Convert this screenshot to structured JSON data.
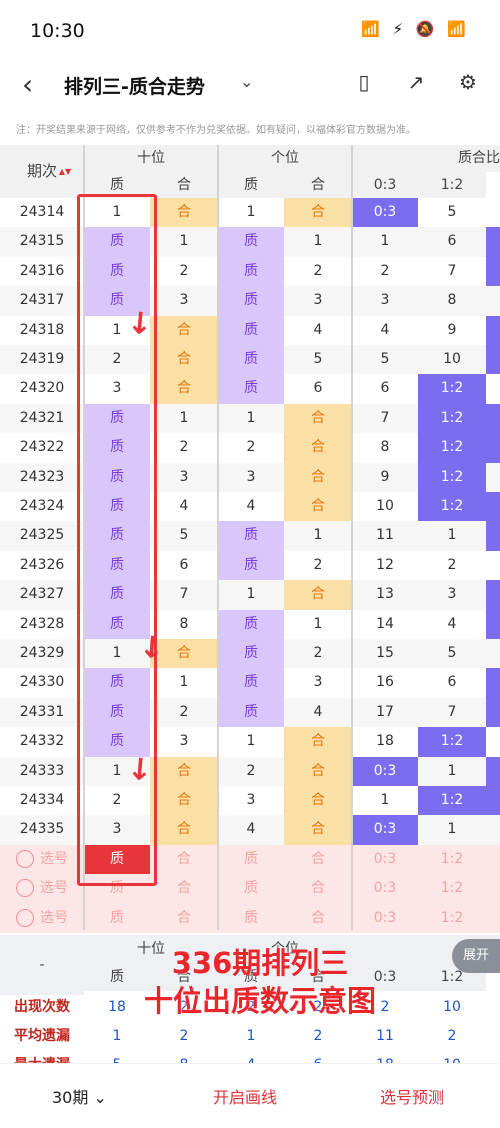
{
  "status": {
    "time": "10:30",
    "icons": "📶 ⚡ 🔕 📶"
  },
  "header": {
    "title": "排列三-质合走势"
  },
  "note": "注：开奖结果来源于网络，仅供参考不作为兑奖依据。如有疑问，以福体彩官方数据为准。",
  "table": {
    "col_period": "期次",
    "sort_mark": "▲▼",
    "group_shi": "十位",
    "group_ge": "个位",
    "group_ratio": "质合比",
    "sub_zhi": "质",
    "sub_he": "合",
    "ratio_03": "0:3",
    "ratio_12": "1:2",
    "rows": [
      {
        "p": "24314",
        "s1": "1",
        "s2": "合",
        "g1": "1",
        "g2": "合",
        "r1": "0:3",
        "r2": "5",
        "a": "h",
        "b": "h",
        "r": "a"
      },
      {
        "p": "24315",
        "s1": "质",
        "s2": "1",
        "g1": "质",
        "g2": "1",
        "r1": "1",
        "r2": "6",
        "a": "z",
        "b": "z",
        "r": "n"
      },
      {
        "p": "24316",
        "s1": "质",
        "s2": "2",
        "g1": "质",
        "g2": "2",
        "r1": "2",
        "r2": "7",
        "a": "z",
        "b": "z",
        "r": "n"
      },
      {
        "p": "24317",
        "s1": "质",
        "s2": "3",
        "g1": "质",
        "g2": "3",
        "r1": "3",
        "r2": "8",
        "a": "z",
        "b": "z",
        "r": "n"
      },
      {
        "p": "24318",
        "s1": "1",
        "s2": "合",
        "g1": "质",
        "g2": "4",
        "r1": "4",
        "r2": "9",
        "a": "h",
        "b": "z",
        "r": "n"
      },
      {
        "p": "24319",
        "s1": "2",
        "s2": "合",
        "g1": "质",
        "g2": "5",
        "r1": "5",
        "r2": "10",
        "a": "h",
        "b": "z",
        "r": "n"
      },
      {
        "p": "24320",
        "s1": "3",
        "s2": "合",
        "g1": "质",
        "g2": "6",
        "r1": "6",
        "r2": "1:2",
        "a": "h",
        "b": "z",
        "r": "b"
      },
      {
        "p": "24321",
        "s1": "质",
        "s2": "1",
        "g1": "1",
        "g2": "合",
        "r1": "7",
        "r2": "1:2",
        "a": "z",
        "b": "h",
        "r": "b"
      },
      {
        "p": "24322",
        "s1": "质",
        "s2": "2",
        "g1": "2",
        "g2": "合",
        "r1": "8",
        "r2": "1:2",
        "a": "z",
        "b": "h",
        "r": "b"
      },
      {
        "p": "24323",
        "s1": "质",
        "s2": "3",
        "g1": "3",
        "g2": "合",
        "r1": "9",
        "r2": "1:2",
        "a": "z",
        "b": "h",
        "r": "b"
      },
      {
        "p": "24324",
        "s1": "质",
        "s2": "4",
        "g1": "4",
        "g2": "合",
        "r1": "10",
        "r2": "1:2",
        "a": "z",
        "b": "h",
        "r": "b"
      },
      {
        "p": "24325",
        "s1": "质",
        "s2": "5",
        "g1": "质",
        "g2": "1",
        "r1": "11",
        "r2": "1",
        "a": "z",
        "b": "z",
        "r": "n"
      },
      {
        "p": "24326",
        "s1": "质",
        "s2": "6",
        "g1": "质",
        "g2": "2",
        "r1": "12",
        "r2": "2",
        "a": "z",
        "b": "z",
        "r": "n"
      },
      {
        "p": "24327",
        "s1": "质",
        "s2": "7",
        "g1": "1",
        "g2": "合",
        "r1": "13",
        "r2": "3",
        "a": "z",
        "b": "h",
        "r": "n"
      },
      {
        "p": "24328",
        "s1": "质",
        "s2": "8",
        "g1": "质",
        "g2": "1",
        "r1": "14",
        "r2": "4",
        "a": "z",
        "b": "z",
        "r": "n"
      },
      {
        "p": "24329",
        "s1": "1",
        "s2": "合",
        "g1": "质",
        "g2": "2",
        "r1": "15",
        "r2": "5",
        "a": "h",
        "b": "z",
        "r": "n"
      },
      {
        "p": "24330",
        "s1": "质",
        "s2": "1",
        "g1": "质",
        "g2": "3",
        "r1": "16",
        "r2": "6",
        "a": "z",
        "b": "z",
        "r": "n"
      },
      {
        "p": "24331",
        "s1": "质",
        "s2": "2",
        "g1": "质",
        "g2": "4",
        "r1": "17",
        "r2": "7",
        "a": "z",
        "b": "z",
        "r": "n"
      },
      {
        "p": "24332",
        "s1": "质",
        "s2": "3",
        "g1": "1",
        "g2": "合",
        "r1": "18",
        "r2": "1:2",
        "a": "z",
        "b": "h",
        "r": "b"
      },
      {
        "p": "24333",
        "s1": "1",
        "s2": "合",
        "g1": "2",
        "g2": "合",
        "r1": "0:3",
        "r2": "1",
        "a": "h",
        "b": "h",
        "r": "a"
      },
      {
        "p": "24334",
        "s1": "2",
        "s2": "合",
        "g1": "3",
        "g2": "合",
        "r1": "1",
        "r2": "1:2",
        "a": "h",
        "b": "h",
        "r": "b"
      },
      {
        "p": "24335",
        "s1": "3",
        "s2": "合",
        "g1": "4",
        "g2": "合",
        "r1": "0:3",
        "r2": "1",
        "a": "h",
        "b": "h",
        "r": "a"
      }
    ],
    "pick_label": "选号",
    "pick_rows": [
      {
        "s1": "质",
        "s2": "合",
        "g1": "质",
        "g2": "合",
        "r1": "0:3",
        "r2": "1:2",
        "hl": true
      },
      {
        "s1": "质",
        "s2": "合",
        "g1": "质",
        "g2": "合",
        "r1": "0:3",
        "r2": "1:2",
        "hl": false
      },
      {
        "s1": "质",
        "s2": "合",
        "g1": "质",
        "g2": "合",
        "r1": "0:3",
        "r2": "1:2",
        "hl": false
      }
    ],
    "bottom_dash": "-",
    "stats": [
      {
        "label": "出现次数",
        "v": [
          "18",
          "2",
          "2",
          "2",
          "2",
          "10"
        ]
      },
      {
        "label": "平均遗漏",
        "v": [
          "1",
          "2",
          "1",
          "2",
          "11",
          "2"
        ]
      },
      {
        "label": "最大遗漏",
        "v": [
          "5",
          "8",
          "4",
          "6",
          "18",
          "10"
        ]
      }
    ]
  },
  "overlay": {
    "line1": "336期排列三",
    "line2": "十位出质数示意图"
  },
  "expand_label": "展开",
  "bottom": {
    "period": "30期",
    "draw_line": "开启画线",
    "predict": "选号预测"
  },
  "colors": {
    "zhi": "#d9c7fb",
    "he": "#fbe0a6",
    "ratio": "#7b6cf0",
    "red": "#e8353a"
  }
}
